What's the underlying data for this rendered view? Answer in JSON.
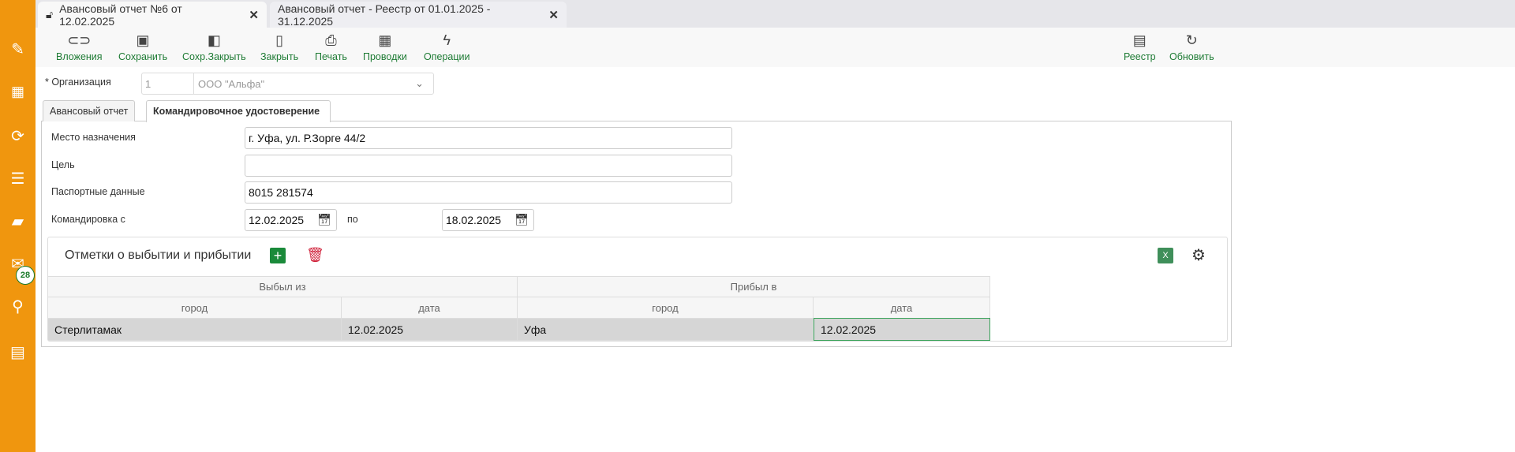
{
  "sidebar": {
    "items": [
      "edit-icon",
      "qr-icon",
      "sync-icon",
      "list-download-icon",
      "folder-icon",
      "mail-icon",
      "search-icon",
      "calendar-icon"
    ],
    "mail_badge": "28"
  },
  "tabs": [
    {
      "label": "Авансовый отчет №6 от 12.02.2025",
      "active": true
    },
    {
      "label": "Авансовый отчет - Реестр от 01.01.2025 - 31.12.2025",
      "active": false
    }
  ],
  "toolbar": {
    "attachments": "Вложения",
    "save": "Сохранить",
    "save_close": "Сохр.Закрыть",
    "close": "Закрыть",
    "print": "Печать",
    "postings": "Проводки",
    "operations": "Операции",
    "registry": "Реестр",
    "refresh": "Обновить"
  },
  "org": {
    "label": "* Организация",
    "code": "1",
    "name": "ООО \"Альфа\""
  },
  "form_tabs": [
    "Авансовый отчет",
    "Командировочное удостоверение"
  ],
  "form": {
    "destination_label": "Место назначения",
    "destination": "г. Уфа, ул. Р.Зорге 44/2",
    "purpose_label": "Цель",
    "purpose": "",
    "passport_label": "Паспортные данные",
    "passport": "8015 281574",
    "trip_from_label": "Командировка с",
    "trip_from": "12.02.2025",
    "trip_to_label": "по",
    "trip_to": "18.02.2025"
  },
  "grid": {
    "title": "Отметки о выбытии и прибытии",
    "excel": "X",
    "groups": [
      "Выбыл из",
      "Прибыл в"
    ],
    "columns": [
      "город",
      "дата",
      "город",
      "дата"
    ],
    "rows": [
      [
        "Стерлитамак",
        "12.02.2025",
        "Уфа",
        "12.02.2025"
      ]
    ]
  }
}
